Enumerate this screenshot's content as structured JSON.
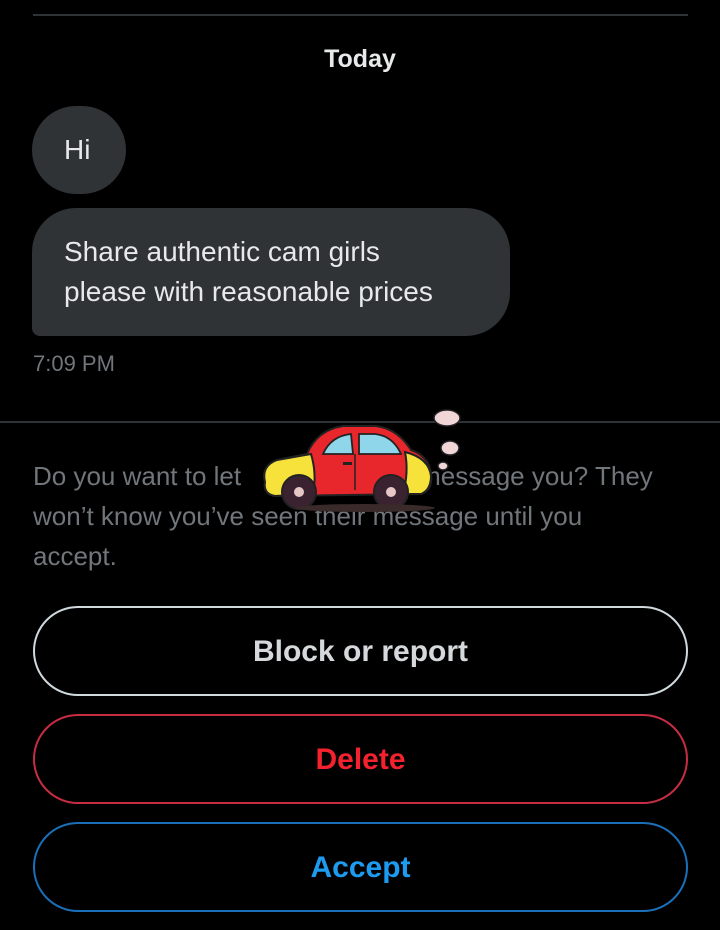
{
  "conversation": {
    "date_label": "Today",
    "messages": [
      {
        "text": "Hi"
      },
      {
        "text_line1": "Share authentic cam girls",
        "text_line2": "please with reasonable prices"
      }
    ],
    "timestamp": "7:09 PM"
  },
  "request": {
    "prompt_line1_before": "Do you want to let",
    "prompt_line1_after": "message you? They",
    "prompt_line2": "won’t know you’ve seen their message until you",
    "prompt_line3": "accept.",
    "sticker_icon": "red-car-sticker-icon"
  },
  "actions": {
    "block_label": "Block or report",
    "delete_label": "Delete",
    "accept_label": "Accept"
  },
  "colors": {
    "background": "#000000",
    "bubble": "#2f3336",
    "muted_text": "#71767b",
    "danger": "#f4212e",
    "primary": "#1d9bf0"
  }
}
